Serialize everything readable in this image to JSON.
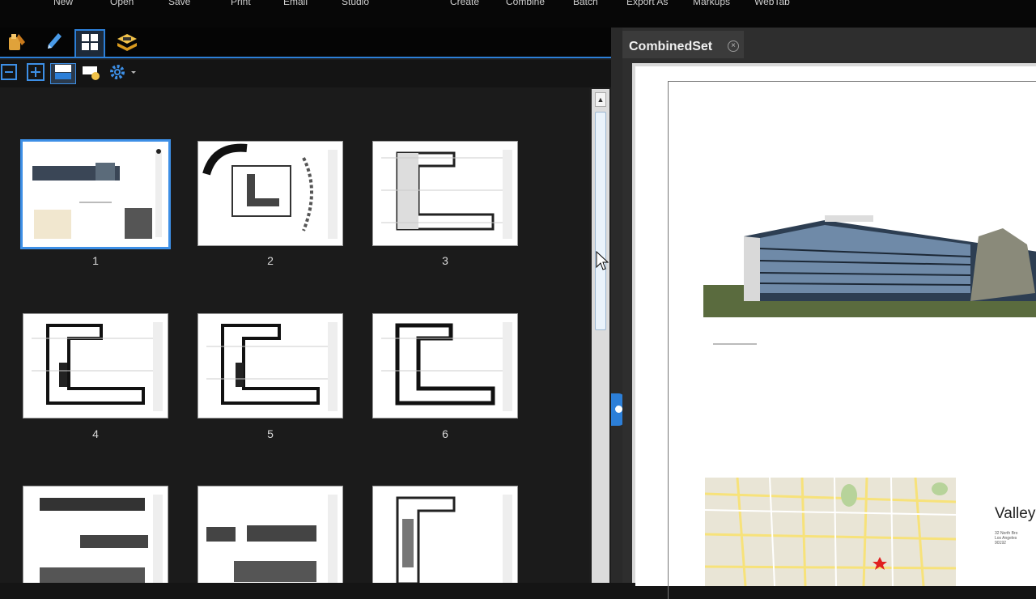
{
  "menu": {
    "items": [
      "New",
      "Open",
      "Save",
      "Print",
      "Email",
      "Studio",
      "Create",
      "Combine",
      "Batch",
      "Export As",
      "Markups",
      "WebTab"
    ]
  },
  "left_panel": {
    "tabs": [
      {
        "name": "studio-tab",
        "icon": "stamp-icon"
      },
      {
        "name": "markup-tab",
        "icon": "pen-icon"
      },
      {
        "name": "thumbnails-tab",
        "icon": "thumbnails-icon",
        "active": true
      },
      {
        "name": "layers-tab",
        "icon": "layers-icon"
      }
    ],
    "tools": [
      "zoom-out-icon",
      "zoom-in-icon",
      "page-view-icon",
      "page-extract-icon",
      "gear-icon"
    ],
    "pages": [
      {
        "number": "1",
        "kind": "cover",
        "selected": true
      },
      {
        "number": "2",
        "kind": "site"
      },
      {
        "number": "3",
        "kind": "plan"
      },
      {
        "number": "4",
        "kind": "plan"
      },
      {
        "number": "5",
        "kind": "plan"
      },
      {
        "number": "6",
        "kind": "plan"
      },
      {
        "number": "",
        "kind": "elevation"
      },
      {
        "number": "",
        "kind": "elevation"
      },
      {
        "number": "",
        "kind": "plan"
      }
    ]
  },
  "document": {
    "tab_title": "CombinedSet",
    "close_glyph": "×",
    "project_title": "Valley",
    "address": [
      "32 North Bro",
      "Los Angeles",
      "90192"
    ]
  },
  "colors": {
    "accent": "#2c7fd8",
    "background": "#1d1d1d"
  }
}
